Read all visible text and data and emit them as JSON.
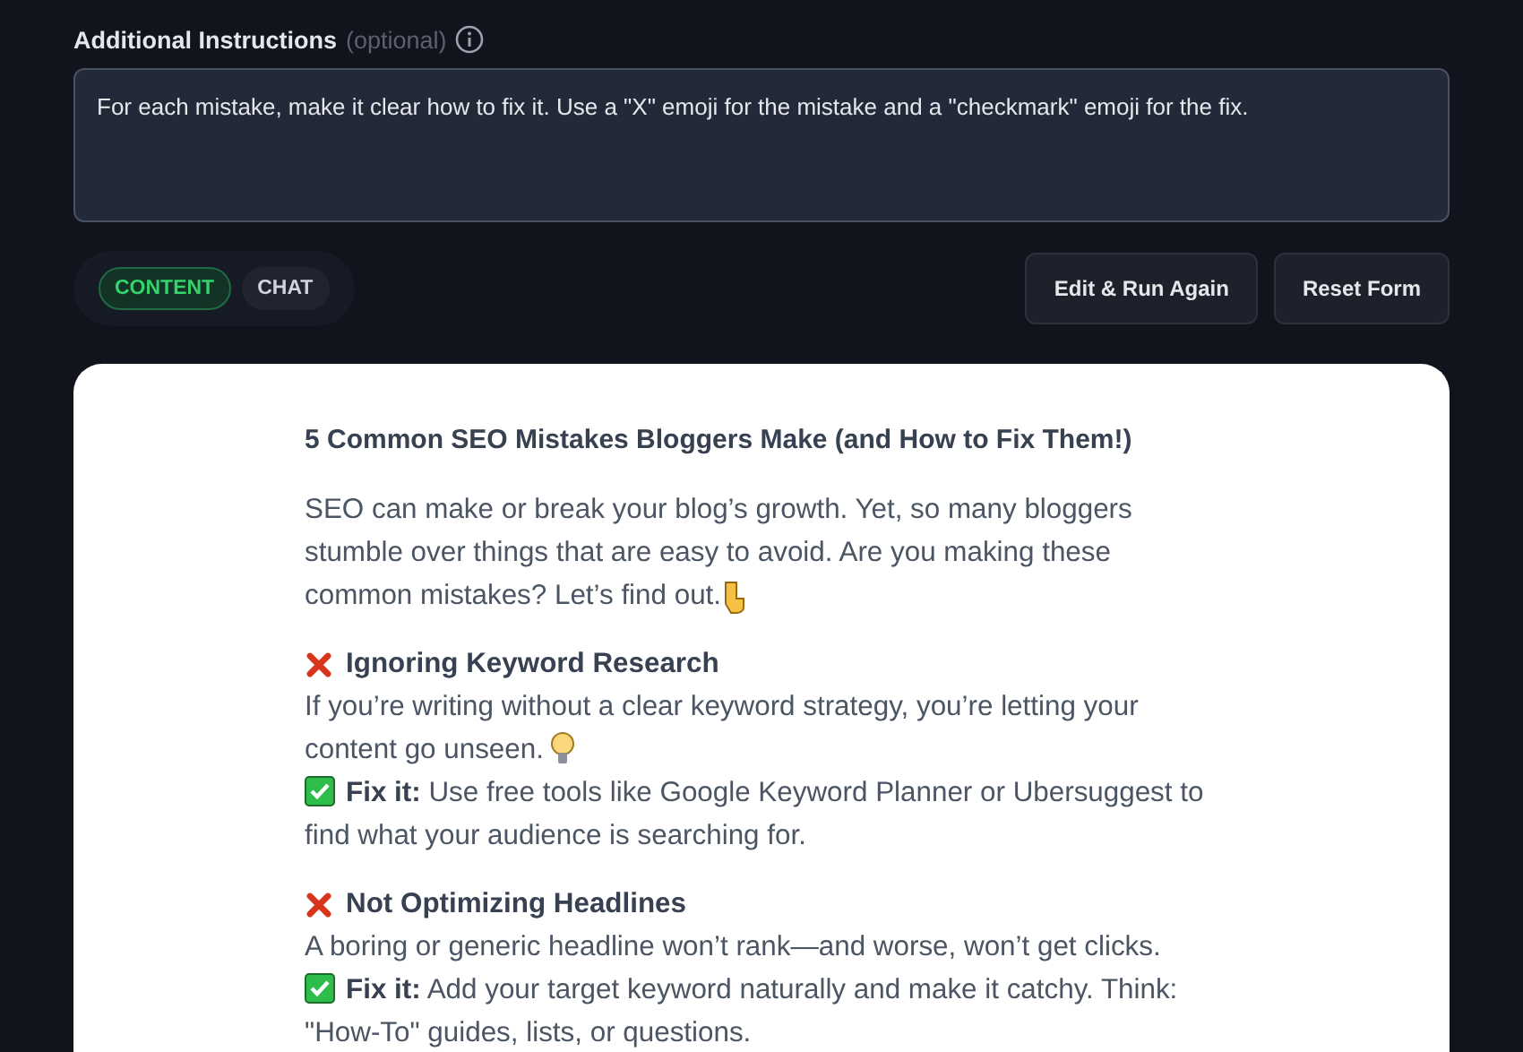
{
  "instructions": {
    "label": "Additional Instructions",
    "hint": "(optional)",
    "value": "For each mistake, make it clear how to fix it. Use a \"X\" emoji for the mistake and a \"checkmark\" emoji for the fix."
  },
  "tabs": [
    {
      "label": "CONTENT",
      "selected": true
    },
    {
      "label": "CHAT",
      "selected": false
    }
  ],
  "buttons": [
    "Edit & Run Again",
    "Reset Form"
  ],
  "article": {
    "title": "5 Common SEO Mistakes Bloggers Make (and How to Fix Them!)",
    "intro": "SEO can make or break your blog’s growth. Yet, so many bloggers stumble over things that are easy to avoid. Are you making these common mistakes? Let’s find out.",
    "sections": [
      {
        "heading": "Ignoring Keyword Research",
        "body": "If you’re writing without a clear keyword strategy, you’re letting your content go unseen.",
        "fix": "**Fix it:** Use free tools like Google Keyword Planner or Ubersuggest to find what your audience is searching for."
      },
      {
        "heading": "Not Optimizing Headlines",
        "body": "A boring or generic headline won’t rank—and worse, won’t get clicks.",
        "fix": "**Fix it:** Add your target keyword naturally and make it catchy. Think: \"How-To\" guides, lists, or questions."
      }
    ]
  }
}
